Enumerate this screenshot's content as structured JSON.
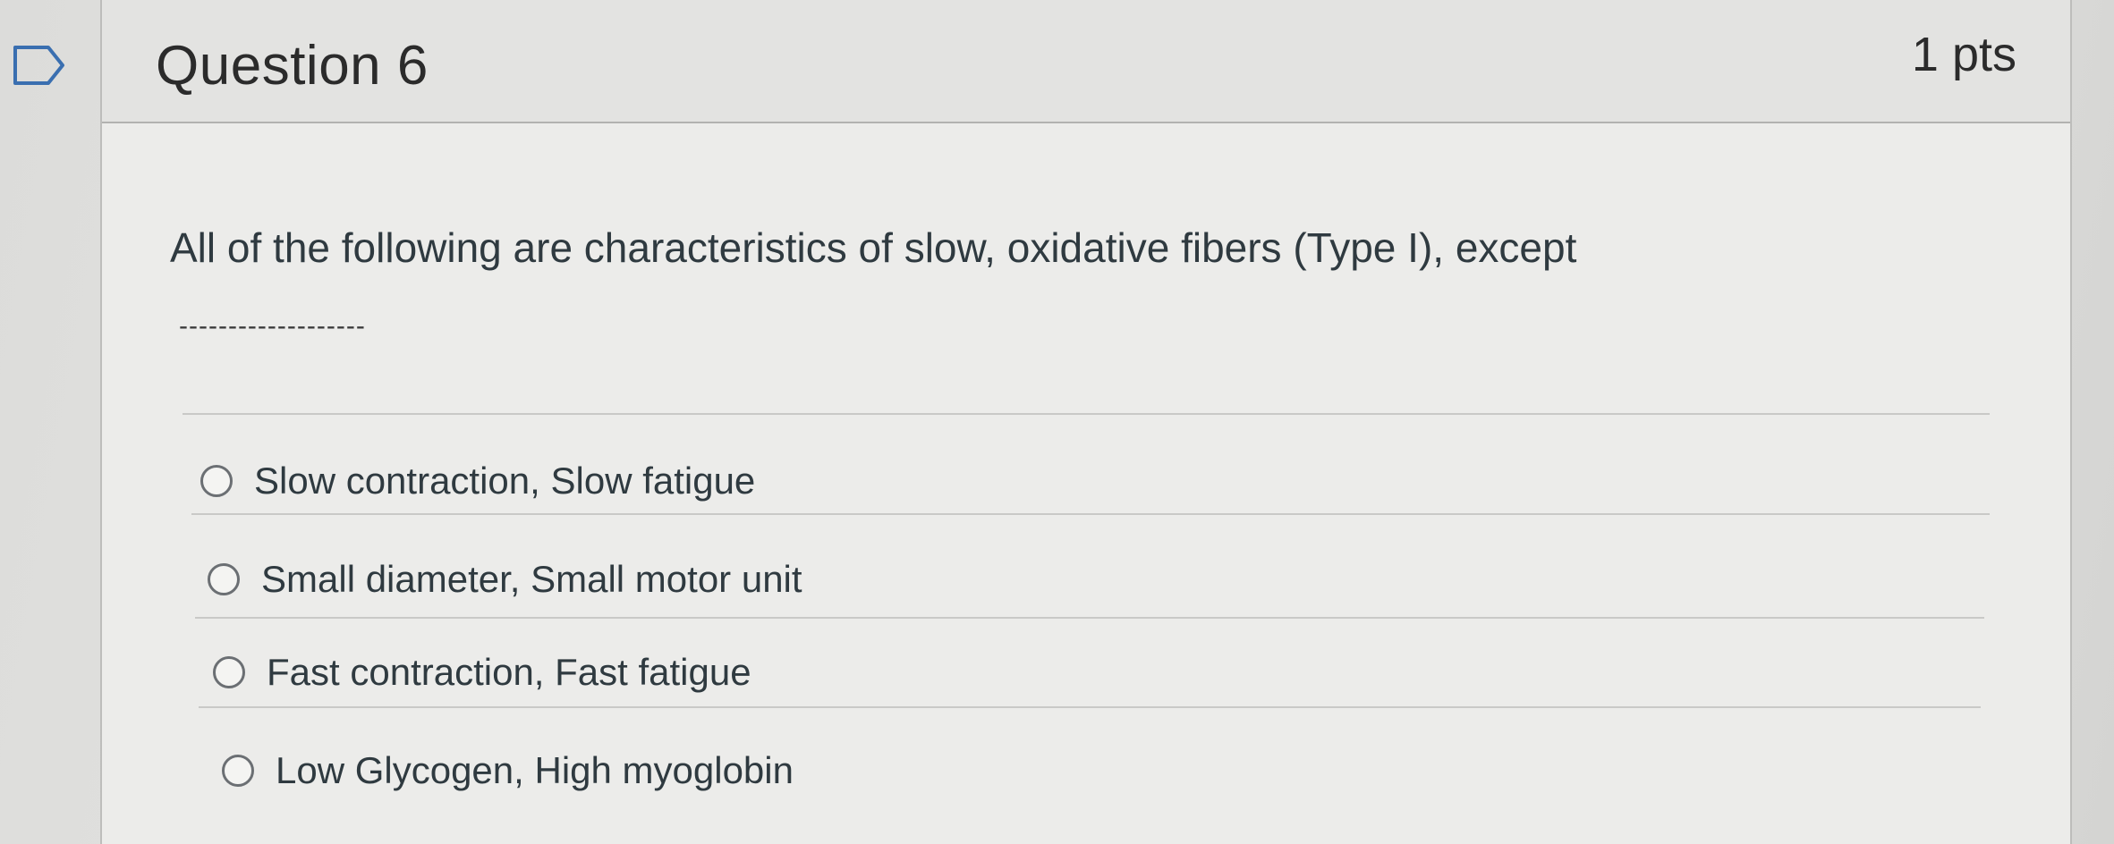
{
  "question": {
    "title": "Question 6",
    "points": "1 pts",
    "text": "All of the following are characteristics of slow, oxidative fibers (Type I), except",
    "blank": "-------------------"
  },
  "answers": [
    {
      "label": "Slow contraction, Slow fatigue"
    },
    {
      "label": "Small diameter, Small motor unit"
    },
    {
      "label": "Fast contraction, Fast fatigue"
    },
    {
      "label": "Low Glycogen, High myoglobin"
    }
  ],
  "icons": {
    "flag": "bookmark-flag-icon",
    "radio": "radio-empty-icon"
  },
  "colors": {
    "text": "#2f3a40",
    "header_background": "#e3e3e1",
    "card_background": "#ececea"
  }
}
